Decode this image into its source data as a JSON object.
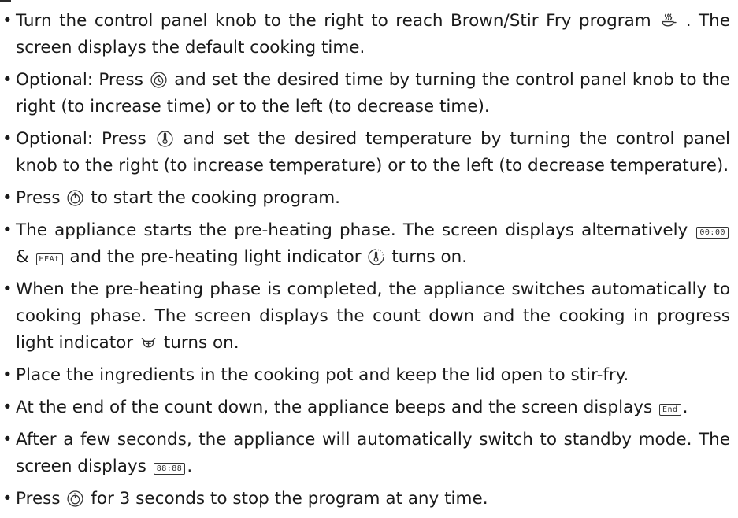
{
  "instructions": [
    {
      "text_1": "Turn the control panel knob to the right to reach Brown/Stir Fry program",
      "icon_1": "brown-stir-fry-icon",
      "text_2": ". The screen displays the default cooking time."
    },
    {
      "text_1": "Optional: Press",
      "icon_1": "timer-icon",
      "text_2": "and set the desired time by turning the control panel knob to the right (to increase time) or to the left (to decrease time)."
    },
    {
      "text_1": "Optional: Press",
      "icon_1": "thermometer-icon",
      "text_2": "and set the desired temperature by turning the control panel knob to the right (to increase temperature) or to the left (to decrease temperature)."
    },
    {
      "text_1": "Press",
      "icon_1": "start-stop-icon",
      "text_2": "to start the cooking program."
    },
    {
      "text_1": "The appliance starts the pre-heating phase. The screen displays alternatively",
      "lcd_1": "00:00",
      "text_2": "&",
      "lcd_2": "HEAt",
      "text_3": "and the pre-heating light indicator",
      "icon_1": "preheat-indicator-icon",
      "text_4": "turns on."
    },
    {
      "text_1": "When the pre-heating phase is completed, the appliance switches automatically to cooking phase. The screen displays the count down and the cooking in progress light indicator",
      "icon_1": "cooking-indicator-icon",
      "text_2": "turns on."
    },
    {
      "text_1": "Place the ingredients in the cooking pot and keep the lid open to stir-fry."
    },
    {
      "text_1": "At the end of the count down, the appliance beeps and the screen displays",
      "lcd_1": "End",
      "text_2": "."
    },
    {
      "text_1": "After a few seconds, the appliance will automatically switch to standby mode. The screen displays",
      "lcd_1": "88:88",
      "text_2": "."
    },
    {
      "text_1": "Press",
      "icon_1": "start-stop-icon",
      "text_2": "for 3 seconds to stop the program at any time."
    }
  ]
}
